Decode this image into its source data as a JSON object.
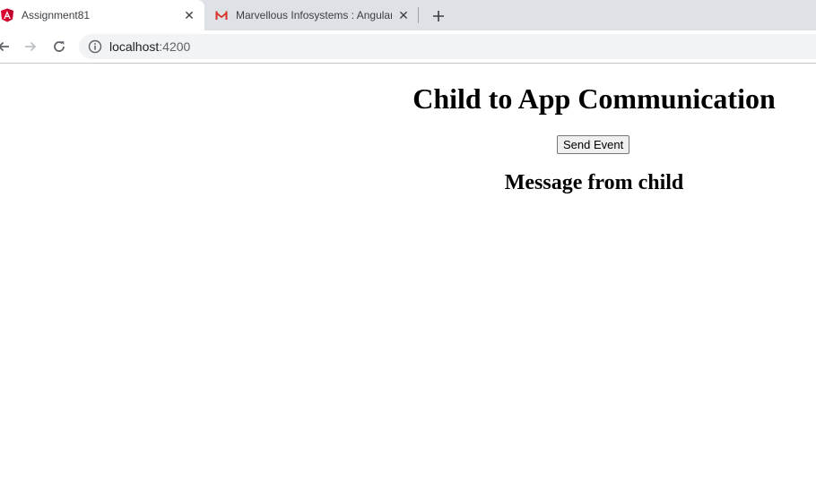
{
  "browser": {
    "tabs": [
      {
        "title": "Assignment81",
        "icon": "angular-logo-icon",
        "active": true
      },
      {
        "title": "Marvellous Infosystems : Angular",
        "icon": "gmail-icon",
        "active": false
      }
    ],
    "close_glyph": "✕",
    "new_tab_icon": "plus-icon",
    "address": {
      "host": "localhost",
      "port": ":4200",
      "info_icon": "info-icon"
    },
    "nav_icons": [
      "back-arrow-icon",
      "forward-arrow-icon",
      "reload-icon"
    ]
  },
  "page": {
    "title": "Child to App Communication",
    "send_button_label": "Send Event",
    "child_message": "Message from child"
  },
  "colors": {
    "tabstrip_bg": "#dee1e6",
    "omnibox_bg": "#f1f3f4",
    "angular_red": "#dd0031",
    "gmail_red": "#d93025"
  }
}
